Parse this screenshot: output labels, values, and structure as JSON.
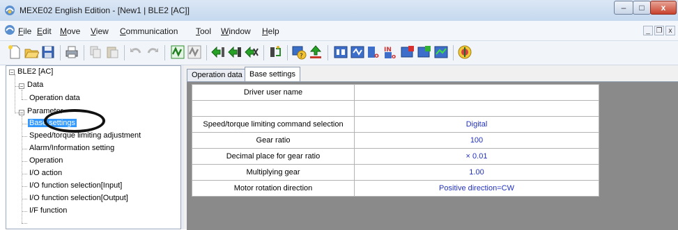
{
  "window": {
    "title": "MEXE02 English Edition - [New1 | BLE2 [AC]]",
    "controls": {
      "minimize": "–",
      "maximize": "□",
      "close": "x"
    }
  },
  "menu": {
    "items": [
      {
        "label": "File"
      },
      {
        "label": "Edit"
      },
      {
        "label": "Move"
      },
      {
        "label": "View"
      },
      {
        "label": "Communication"
      },
      {
        "label": "Tool"
      },
      {
        "label": "Window"
      },
      {
        "label": "Help"
      }
    ],
    "mdi_controls": {
      "minimize": "_",
      "restore": "❐",
      "close": "x"
    }
  },
  "tree": {
    "root": "BLE2 [AC]",
    "data_group": "Data",
    "data_items": [
      "Operation data"
    ],
    "param_group": "Parameter",
    "param_items": [
      "Base settings",
      "Speed/torque limiting adjustment",
      "Alarm/Information setting",
      "Operation",
      "I/O action",
      "I/O function selection[Input]",
      "I/O function selection[Output]",
      "I/F function"
    ],
    "selected": "Base settings"
  },
  "tabs": [
    {
      "label": "Operation data",
      "active": false
    },
    {
      "label": "Base settings",
      "active": true
    }
  ],
  "settings": [
    {
      "label": "Driver user name",
      "value": ""
    },
    {
      "label": "",
      "value": ""
    },
    {
      "label": "Speed/torque limiting command selection",
      "value": "Digital"
    },
    {
      "label": "Gear ratio",
      "value": "100"
    },
    {
      "label": "Decimal place for gear ratio",
      "value": "× 0.01"
    },
    {
      "label": "Multiplying gear",
      "value": "1.00"
    },
    {
      "label": "Motor rotation direction",
      "value": "Positive direction=CW"
    }
  ],
  "colors": {
    "value_text": "#2030c0",
    "selection": "#3399ff",
    "annotation_circle": "#111111"
  }
}
